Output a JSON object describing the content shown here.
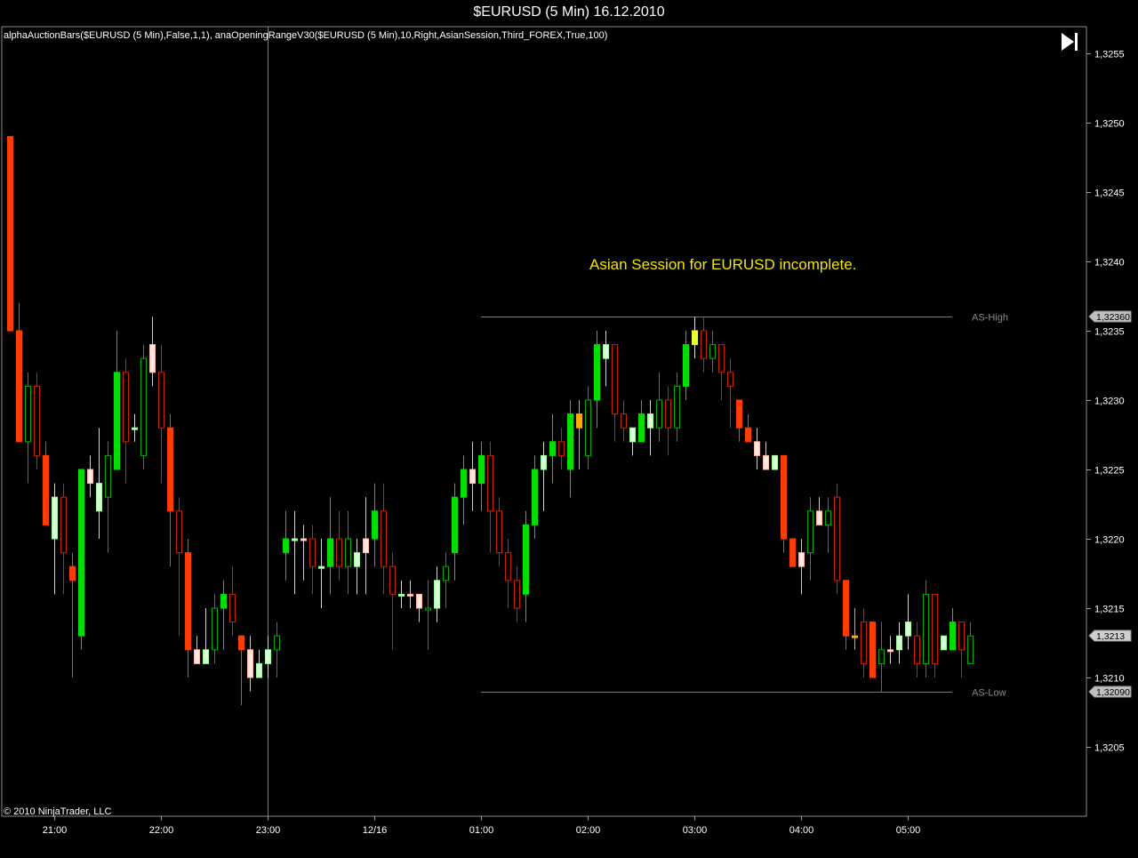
{
  "window": {
    "title": "$EURUSD (5 Min)  16.12.2010"
  },
  "indicators": "alphaAuctionBars($EURUSD  (5  Min),False,1,1),  anaOpeningRangeV30($EURUSD  (5  Min),10,Right,AsianSession,Third_FOREX,True,100)",
  "copyright": "© 2010 NinjaTrader, LLC",
  "controls": {
    "go_to_end_icon": "skip-to-end-icon"
  },
  "colors": {
    "up_strong": "#00e000",
    "up_hollow": "#00b000",
    "down_strong": "#ff3d00",
    "down_hollow": "#cc2200",
    "up_light": "#d8ffd8",
    "down_light": "#ffe8e0",
    "amber": "#ffaa00",
    "yellow": "#e8ff30"
  },
  "chart_data": {
    "type": "candlestick",
    "title": "$EURUSD (5 Min)  16.12.2010",
    "annotation": "Asian Session for EURUSD incomplete.",
    "y_axis": {
      "min": 1.3201,
      "max": 1.3258,
      "ticks": [
        "1,3255",
        "1,3250",
        "1,3245",
        "1,3240",
        "1,3235",
        "1,3230",
        "1,3225",
        "1,3220",
        "1,3215",
        "1,3210",
        "1,3205"
      ]
    },
    "x_axis": {
      "ticks": [
        "21:00",
        "22:00",
        "23:00",
        "12/16",
        "01:00",
        "02:00",
        "03:00",
        "04:00",
        "05:00"
      ]
    },
    "session_start": "23:00",
    "levels": [
      {
        "name": "AS-High",
        "price": 1.3236,
        "badge": "1,32360"
      },
      {
        "name": "AS-Low",
        "price": 1.3209,
        "badge": "1,32090"
      }
    ],
    "last_price": {
      "price": 1.3213,
      "badge": "1,3213"
    },
    "candles": [
      {
        "t": "20:35",
        "o": 1.3249,
        "h": 1.3249,
        "l": 1.3235,
        "c": 1.3235,
        "s": "ds"
      },
      {
        "t": "20:40",
        "o": 1.3235,
        "h": 1.3237,
        "l": 1.3227,
        "c": 1.3227,
        "s": "ds"
      },
      {
        "t": "20:45",
        "o": 1.3227,
        "h": 1.3232,
        "l": 1.3224,
        "c": 1.3231,
        "s": "uh"
      },
      {
        "t": "20:50",
        "o": 1.3231,
        "h": 1.3232,
        "l": 1.3225,
        "c": 1.3226,
        "s": "dh"
      },
      {
        "t": "20:55",
        "o": 1.3226,
        "h": 1.3227,
        "l": 1.3221,
        "c": 1.3221,
        "s": "ds"
      },
      {
        "t": "21:00",
        "o": 1.322,
        "h": 1.3224,
        "l": 1.3216,
        "c": 1.3223,
        "s": "ul"
      },
      {
        "t": "21:05",
        "o": 1.3223,
        "h": 1.3224,
        "l": 1.3216,
        "c": 1.3219,
        "s": "dh"
      },
      {
        "t": "21:10",
        "o": 1.3218,
        "h": 1.3219,
        "l": 1.321,
        "c": 1.3217,
        "s": "ds"
      },
      {
        "t": "21:15",
        "o": 1.3213,
        "h": 1.3225,
        "l": 1.3212,
        "c": 1.3225,
        "s": "us"
      },
      {
        "t": "21:20",
        "o": 1.3225,
        "h": 1.3226,
        "l": 1.3223,
        "c": 1.3224,
        "s": "dl"
      },
      {
        "t": "21:25",
        "o": 1.3222,
        "h": 1.3228,
        "l": 1.322,
        "c": 1.3224,
        "s": "ul"
      },
      {
        "t": "21:30",
        "o": 1.3223,
        "h": 1.3227,
        "l": 1.3219,
        "c": 1.3226,
        "s": "uh"
      },
      {
        "t": "21:35",
        "o": 1.3225,
        "h": 1.3235,
        "l": 1.3225,
        "c": 1.3232,
        "s": "us"
      },
      {
        "t": "21:40",
        "o": 1.3232,
        "h": 1.3233,
        "l": 1.3224,
        "c": 1.3227,
        "s": "dh"
      },
      {
        "t": "21:45",
        "o": 1.3228,
        "h": 1.3229,
        "l": 1.3227,
        "c": 1.3228,
        "s": "ul"
      },
      {
        "t": "21:50",
        "o": 1.3226,
        "h": 1.3234,
        "l": 1.3225,
        "c": 1.3233,
        "s": "uh"
      },
      {
        "t": "21:55",
        "o": 1.3234,
        "h": 1.3236,
        "l": 1.3231,
        "c": 1.3232,
        "s": "dl"
      },
      {
        "t": "22:00",
        "o": 1.3232,
        "h": 1.3234,
        "l": 1.3224,
        "c": 1.3228,
        "s": "dh"
      },
      {
        "t": "22:05",
        "o": 1.3228,
        "h": 1.3229,
        "l": 1.3218,
        "c": 1.3222,
        "s": "ds"
      },
      {
        "t": "22:10",
        "o": 1.3222,
        "h": 1.3223,
        "l": 1.3213,
        "c": 1.3219,
        "s": "dh"
      },
      {
        "t": "22:15",
        "o": 1.3219,
        "h": 1.322,
        "l": 1.321,
        "c": 1.3212,
        "s": "ds"
      },
      {
        "t": "22:20",
        "o": 1.3212,
        "h": 1.3213,
        "l": 1.3211,
        "c": 1.3211,
        "s": "dl"
      },
      {
        "t": "22:25",
        "o": 1.3211,
        "h": 1.3215,
        "l": 1.3211,
        "c": 1.3212,
        "s": "ul"
      },
      {
        "t": "22:30",
        "o": 1.3212,
        "h": 1.3216,
        "l": 1.3211,
        "c": 1.3215,
        "s": "uh"
      },
      {
        "t": "22:35",
        "o": 1.3215,
        "h": 1.3217,
        "l": 1.3212,
        "c": 1.3216,
        "s": "us"
      },
      {
        "t": "22:40",
        "o": 1.3216,
        "h": 1.3218,
        "l": 1.3213,
        "c": 1.3214,
        "s": "dh"
      },
      {
        "t": "22:45",
        "o": 1.3213,
        "h": 1.3213,
        "l": 1.3208,
        "c": 1.3212,
        "s": "ds"
      },
      {
        "t": "22:50",
        "o": 1.3212,
        "h": 1.3213,
        "l": 1.3209,
        "c": 1.321,
        "s": "dl"
      },
      {
        "t": "22:55",
        "o": 1.321,
        "h": 1.3212,
        "l": 1.321,
        "c": 1.3211,
        "s": "ul"
      },
      {
        "t": "23:00",
        "o": 1.3211,
        "h": 1.3213,
        "l": 1.321,
        "c": 1.3212,
        "s": "ul"
      },
      {
        "t": "23:05",
        "o": 1.3212,
        "h": 1.3214,
        "l": 1.321,
        "c": 1.3213,
        "s": "uh"
      },
      {
        "t": "23:10",
        "o": 1.3219,
        "h": 1.3222,
        "l": 1.3217,
        "c": 1.322,
        "s": "us"
      },
      {
        "t": "23:15",
        "o": 1.322,
        "h": 1.3222,
        "l": 1.3216,
        "c": 1.322,
        "s": "ul"
      },
      {
        "t": "23:20",
        "o": 1.322,
        "h": 1.3221,
        "l": 1.3217,
        "c": 1.322,
        "s": "dl"
      },
      {
        "t": "23:25",
        "o": 1.322,
        "h": 1.3221,
        "l": 1.3216,
        "c": 1.3218,
        "s": "dh"
      },
      {
        "t": "23:30",
        "o": 1.3218,
        "h": 1.322,
        "l": 1.3215,
        "c": 1.3218,
        "s": "ul"
      },
      {
        "t": "23:35",
        "o": 1.3218,
        "h": 1.3223,
        "l": 1.3216,
        "c": 1.322,
        "s": "us"
      },
      {
        "t": "23:40",
        "o": 1.322,
        "h": 1.3222,
        "l": 1.3217,
        "c": 1.3218,
        "s": "dh"
      },
      {
        "t": "23:45",
        "o": 1.3218,
        "h": 1.3222,
        "l": 1.3216,
        "c": 1.322,
        "s": "uh"
      },
      {
        "t": "23:50",
        "o": 1.3219,
        "h": 1.322,
        "l": 1.3216,
        "c": 1.3218,
        "s": "ul"
      },
      {
        "t": "23:55",
        "o": 1.3219,
        "h": 1.3223,
        "l": 1.3216,
        "c": 1.322,
        "s": "dl"
      },
      {
        "t": "00:00",
        "o": 1.322,
        "h": 1.3224,
        "l": 1.3218,
        "c": 1.3222,
        "s": "us"
      },
      {
        "t": "00:05",
        "o": 1.3222,
        "h": 1.3224,
        "l": 1.3216,
        "c": 1.3218,
        "s": "dh"
      },
      {
        "t": "00:10",
        "o": 1.3218,
        "h": 1.3219,
        "l": 1.3212,
        "c": 1.3216,
        "s": "dh"
      },
      {
        "t": "00:15",
        "o": 1.3216,
        "h": 1.3217,
        "l": 1.3215,
        "c": 1.3216,
        "s": "ul"
      },
      {
        "t": "00:20",
        "o": 1.3216,
        "h": 1.3217,
        "l": 1.3215,
        "c": 1.3216,
        "s": "dl"
      },
      {
        "t": "00:25",
        "o": 1.3216,
        "h": 1.3216,
        "l": 1.3214,
        "c": 1.3215,
        "s": "dl"
      },
      {
        "t": "00:30",
        "o": 1.3215,
        "h": 1.3217,
        "l": 1.3212,
        "c": 1.3215,
        "s": "uh"
      },
      {
        "t": "00:35",
        "o": 1.3215,
        "h": 1.3218,
        "l": 1.3214,
        "c": 1.3217,
        "s": "ul"
      },
      {
        "t": "00:40",
        "o": 1.3217,
        "h": 1.3219,
        "l": 1.3215,
        "c": 1.3218,
        "s": "uh"
      },
      {
        "t": "00:45",
        "o": 1.3219,
        "h": 1.3224,
        "l": 1.3217,
        "c": 1.3223,
        "s": "us"
      },
      {
        "t": "00:50",
        "o": 1.3223,
        "h": 1.3226,
        "l": 1.3221,
        "c": 1.3225,
        "s": "us"
      },
      {
        "t": "00:55",
        "o": 1.3225,
        "h": 1.3227,
        "l": 1.3222,
        "c": 1.3224,
        "s": "dl"
      },
      {
        "t": "01:00",
        "o": 1.3224,
        "h": 1.3227,
        "l": 1.3222,
        "c": 1.3226,
        "s": "us"
      },
      {
        "t": "01:05",
        "o": 1.3226,
        "h": 1.3227,
        "l": 1.3219,
        "c": 1.3222,
        "s": "dh"
      },
      {
        "t": "01:10",
        "o": 1.3222,
        "h": 1.3223,
        "l": 1.3218,
        "c": 1.3219,
        "s": "dh"
      },
      {
        "t": "01:15",
        "o": 1.3219,
        "h": 1.322,
        "l": 1.3215,
        "c": 1.3217,
        "s": "dh"
      },
      {
        "t": "01:20",
        "o": 1.3217,
        "h": 1.3218,
        "l": 1.3214,
        "c": 1.3215,
        "s": "dh"
      },
      {
        "t": "01:25",
        "o": 1.3216,
        "h": 1.3222,
        "l": 1.3214,
        "c": 1.3221,
        "s": "us"
      },
      {
        "t": "01:30",
        "o": 1.3221,
        "h": 1.3226,
        "l": 1.322,
        "c": 1.3225,
        "s": "us"
      },
      {
        "t": "01:35",
        "o": 1.3225,
        "h": 1.3227,
        "l": 1.3222,
        "c": 1.3226,
        "s": "ul"
      },
      {
        "t": "01:40",
        "o": 1.3226,
        "h": 1.3229,
        "l": 1.3224,
        "c": 1.3227,
        "s": "us"
      },
      {
        "t": "01:45",
        "o": 1.3227,
        "h": 1.3228,
        "l": 1.3225,
        "c": 1.3226,
        "s": "dh"
      },
      {
        "t": "01:50",
        "o": 1.3225,
        "h": 1.323,
        "l": 1.3223,
        "c": 1.3229,
        "s": "us"
      },
      {
        "t": "01:55",
        "o": 1.3229,
        "h": 1.323,
        "l": 1.3225,
        "c": 1.3228,
        "s": "da"
      },
      {
        "t": "02:00",
        "o": 1.3226,
        "h": 1.3231,
        "l": 1.3225,
        "c": 1.323,
        "s": "uh"
      },
      {
        "t": "02:05",
        "o": 1.323,
        "h": 1.3235,
        "l": 1.3228,
        "c": 1.3234,
        "s": "us"
      },
      {
        "t": "02:10",
        "o": 1.3233,
        "h": 1.3235,
        "l": 1.3231,
        "c": 1.3234,
        "s": "ul"
      },
      {
        "t": "02:15",
        "o": 1.3234,
        "h": 1.3234,
        "l": 1.3227,
        "c": 1.3229,
        "s": "dh"
      },
      {
        "t": "02:20",
        "o": 1.3229,
        "h": 1.323,
        "l": 1.3227,
        "c": 1.3228,
        "s": "dh"
      },
      {
        "t": "02:25",
        "o": 1.3227,
        "h": 1.3228,
        "l": 1.3226,
        "c": 1.3228,
        "s": "ul"
      },
      {
        "t": "02:30",
        "o": 1.3227,
        "h": 1.323,
        "l": 1.3227,
        "c": 1.3229,
        "s": "us"
      },
      {
        "t": "02:35",
        "o": 1.3229,
        "h": 1.323,
        "l": 1.3226,
        "c": 1.3228,
        "s": "ul"
      },
      {
        "t": "02:40",
        "o": 1.3228,
        "h": 1.3232,
        "l": 1.3227,
        "c": 1.323,
        "s": "uh"
      },
      {
        "t": "02:45",
        "o": 1.323,
        "h": 1.3231,
        "l": 1.3226,
        "c": 1.3228,
        "s": "dh"
      },
      {
        "t": "02:50",
        "o": 1.3228,
        "h": 1.3232,
        "l": 1.3227,
        "c": 1.3231,
        "s": "uh"
      },
      {
        "t": "02:55",
        "o": 1.3231,
        "h": 1.3235,
        "l": 1.323,
        "c": 1.3234,
        "s": "us"
      },
      {
        "t": "03:00",
        "o": 1.3234,
        "h": 1.3236,
        "l": 1.3233,
        "c": 1.3235,
        "s": "uy"
      },
      {
        "t": "03:05",
        "o": 1.3235,
        "h": 1.3236,
        "l": 1.3232,
        "c": 1.3233,
        "s": "dh"
      },
      {
        "t": "03:10",
        "o": 1.3233,
        "h": 1.3235,
        "l": 1.3232,
        "c": 1.3234,
        "s": "uh"
      },
      {
        "t": "03:15",
        "o": 1.3234,
        "h": 1.3234,
        "l": 1.323,
        "c": 1.3232,
        "s": "dh"
      },
      {
        "t": "03:20",
        "o": 1.3232,
        "h": 1.3233,
        "l": 1.3228,
        "c": 1.3231,
        "s": "dh"
      },
      {
        "t": "03:25",
        "o": 1.323,
        "h": 1.323,
        "l": 1.3227,
        "c": 1.3228,
        "s": "ds"
      },
      {
        "t": "03:30",
        "o": 1.3228,
        "h": 1.3229,
        "l": 1.3227,
        "c": 1.3227,
        "s": "ds"
      },
      {
        "t": "03:35",
        "o": 1.3227,
        "h": 1.3228,
        "l": 1.3225,
        "c": 1.3226,
        "s": "dl"
      },
      {
        "t": "03:40",
        "o": 1.3226,
        "h": 1.3227,
        "l": 1.3225,
        "c": 1.3225,
        "s": "dl"
      },
      {
        "t": "03:45",
        "o": 1.3225,
        "h": 1.3226,
        "l": 1.3225,
        "c": 1.3226,
        "s": "ul"
      },
      {
        "t": "03:50",
        "o": 1.3226,
        "h": 1.3226,
        "l": 1.3219,
        "c": 1.322,
        "s": "ds"
      },
      {
        "t": "03:55",
        "o": 1.322,
        "h": 1.322,
        "l": 1.3218,
        "c": 1.3218,
        "s": "ds"
      },
      {
        "t": "04:00",
        "o": 1.3219,
        "h": 1.322,
        "l": 1.3216,
        "c": 1.3218,
        "s": "dl"
      },
      {
        "t": "04:05",
        "o": 1.3219,
        "h": 1.3223,
        "l": 1.3217,
        "c": 1.3222,
        "s": "uh"
      },
      {
        "t": "04:10",
        "o": 1.3222,
        "h": 1.3223,
        "l": 1.3221,
        "c": 1.3221,
        "s": "dl"
      },
      {
        "t": "04:15",
        "o": 1.3221,
        "h": 1.3223,
        "l": 1.3219,
        "c": 1.3222,
        "s": "uh"
      },
      {
        "t": "04:20",
        "o": 1.3223,
        "h": 1.3224,
        "l": 1.3216,
        "c": 1.3217,
        "s": "dh"
      },
      {
        "t": "04:25",
        "o": 1.3217,
        "h": 1.3217,
        "l": 1.3212,
        "c": 1.3213,
        "s": "ds"
      },
      {
        "t": "04:30",
        "o": 1.3213,
        "h": 1.3215,
        "l": 1.3212,
        "c": 1.3213,
        "s": "da"
      },
      {
        "t": "04:35",
        "o": 1.3214,
        "h": 1.3215,
        "l": 1.321,
        "c": 1.3211,
        "s": "dh"
      },
      {
        "t": "04:40",
        "o": 1.3214,
        "h": 1.3214,
        "l": 1.321,
        "c": 1.321,
        "s": "ds"
      },
      {
        "t": "04:45",
        "o": 1.3211,
        "h": 1.3214,
        "l": 1.3209,
        "c": 1.3212,
        "s": "uh"
      },
      {
        "t": "04:50",
        "o": 1.3212,
        "h": 1.3213,
        "l": 1.3211,
        "c": 1.3212,
        "s": "dl"
      },
      {
        "t": "04:55",
        "o": 1.3212,
        "h": 1.3214,
        "l": 1.3211,
        "c": 1.3213,
        "s": "ul"
      },
      {
        "t": "05:00",
        "o": 1.3213,
        "h": 1.3216,
        "l": 1.3212,
        "c": 1.3214,
        "s": "ul"
      },
      {
        "t": "05:05",
        "o": 1.3213,
        "h": 1.3214,
        "l": 1.321,
        "c": 1.3211,
        "s": "dh"
      },
      {
        "t": "05:10",
        "o": 1.3211,
        "h": 1.3217,
        "l": 1.321,
        "c": 1.3216,
        "s": "uh"
      },
      {
        "t": "05:15",
        "o": 1.3216,
        "h": 1.3216,
        "l": 1.321,
        "c": 1.3211,
        "s": "dh"
      },
      {
        "t": "05:20",
        "o": 1.3212,
        "h": 1.3213,
        "l": 1.3212,
        "c": 1.3213,
        "s": "ul"
      },
      {
        "t": "05:25",
        "o": 1.3212,
        "h": 1.3215,
        "l": 1.3212,
        "c": 1.3214,
        "s": "us"
      },
      {
        "t": "05:30",
        "o": 1.3214,
        "h": 1.3214,
        "l": 1.321,
        "c": 1.3212,
        "s": "dh"
      },
      {
        "t": "05:35",
        "o": 1.3211,
        "h": 1.3214,
        "l": 1.3211,
        "c": 1.3213,
        "s": "uh"
      }
    ]
  }
}
